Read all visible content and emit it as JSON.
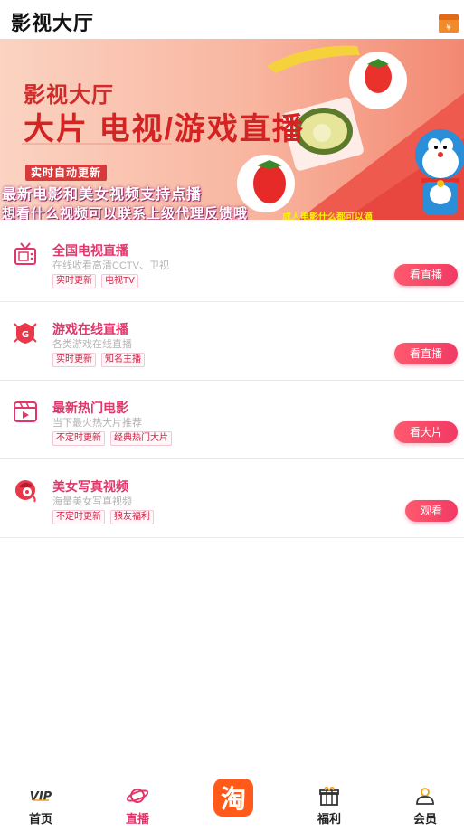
{
  "header": {
    "title": "影视大厅",
    "wallet_icon": "wallet-icon"
  },
  "banner": {
    "subtitle": "影视大厅",
    "headline": "大片 电视/游戏直播",
    "badge": "实时自动更新",
    "line1": "最新电影和美女视频支持点播",
    "line2": "想看什么视频可以联系上级代理反馈哦",
    "small_note": "成人电影什么都可以滴"
  },
  "items": [
    {
      "name": "全国电视直播",
      "desc": "在线收看高清CCTV、卫视",
      "tags": [
        "实时更新",
        "电视TV"
      ],
      "button": "看直播",
      "icon": "tv-icon"
    },
    {
      "name": "游戏在线直播",
      "desc": "各类游戏在线直播",
      "tags": [
        "实时更新",
        "知名主播"
      ],
      "button": "看直播",
      "icon": "game-icon"
    },
    {
      "name": "最新热门电影",
      "desc": "当下最火热大片推荐",
      "tags": [
        "不定时更新",
        "经典热门大片"
      ],
      "button": "看大片",
      "icon": "film-icon"
    },
    {
      "name": "美女写真视频",
      "desc": "海量美女写真视频",
      "tags": [
        "不定时更新",
        "狼友福利"
      ],
      "button": "观看",
      "icon": "beauty-icon"
    }
  ],
  "nav": {
    "items": [
      {
        "label": "首页",
        "icon": "vip-icon"
      },
      {
        "label": "直播",
        "icon": "planet-icon",
        "active": true
      },
      {
        "label": "",
        "icon": "taobao-icon"
      },
      {
        "label": "福利",
        "icon": "gift-icon"
      },
      {
        "label": "会员",
        "icon": "user-icon"
      }
    ],
    "center_glyph": "淘"
  },
  "colors": {
    "accent": "#e0366a",
    "button": "#f03a64",
    "banner_bg": "#f7b8a0"
  }
}
